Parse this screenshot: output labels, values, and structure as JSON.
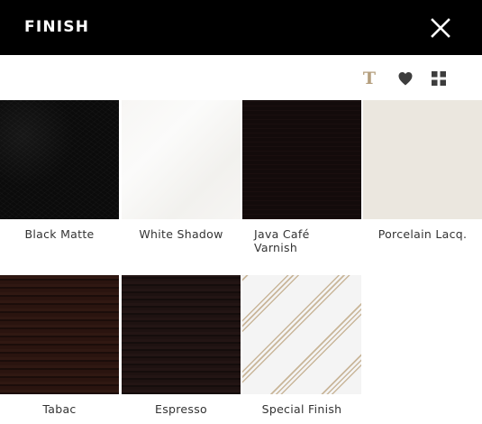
{
  "header": {
    "title": "FINISH",
    "close_icon": "close-icon"
  },
  "toolbar": {
    "icons": [
      "text-icon",
      "heart-icon",
      "grid-icon"
    ],
    "text_glyph": "T",
    "accent_color": "#b59f7e"
  },
  "finishes": [
    {
      "name": "Black Matte",
      "color": "#0b0b0b"
    },
    {
      "name": "White Shadow",
      "color": "#f7f6f4"
    },
    {
      "name": "Java Café Varnish",
      "color": "#130b0b"
    },
    {
      "name": "Porcelain Lacq.",
      "color": "#ebe7df"
    },
    {
      "name": "Tabac",
      "color": "#2a140f"
    },
    {
      "name": "Espresso",
      "color": "#1e1211"
    },
    {
      "name": "Special Finish",
      "color": "#f4f4f4"
    }
  ]
}
